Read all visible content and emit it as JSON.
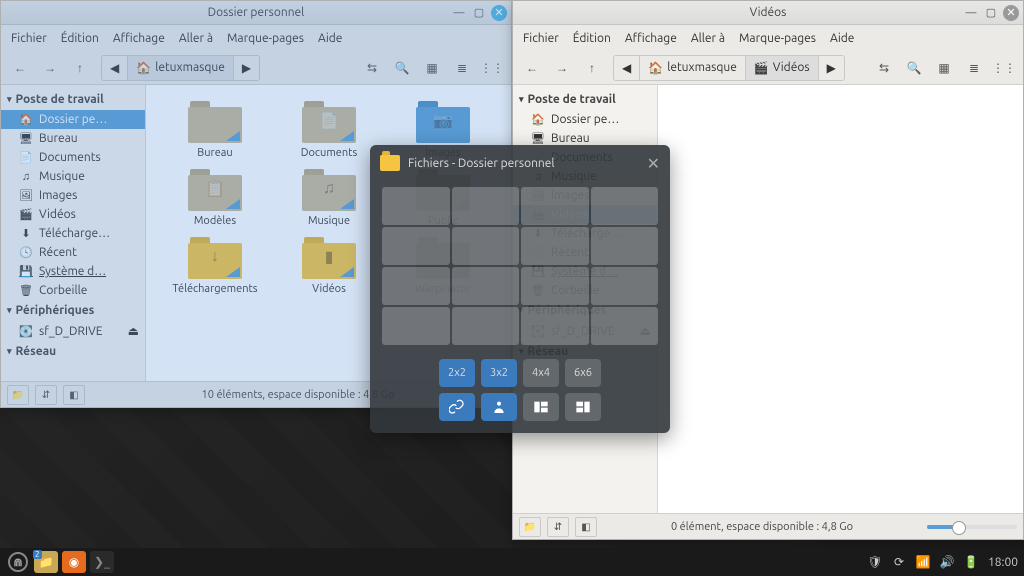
{
  "win_left": {
    "title": "Dossier personnel",
    "menu": [
      "Fichier",
      "Édition",
      "Affichage",
      "Aller à",
      "Marque-pages",
      "Aide"
    ],
    "path_user": "letuxmasque",
    "status": "10 éléments, espace disponible : 4,8 Go",
    "folders": [
      {
        "label": "Bureau",
        "color": "tan",
        "glyph": ""
      },
      {
        "label": "Documents",
        "color": "tan",
        "glyph": "📄"
      },
      {
        "label": "Images",
        "color": "blue",
        "glyph": "📷"
      },
      {
        "label": "Modèles",
        "color": "tan",
        "glyph": "📋"
      },
      {
        "label": "Musique",
        "color": "tan",
        "glyph": "♫"
      },
      {
        "label": "Public",
        "color": "tan",
        "glyph": ""
      },
      {
        "label": "Téléchargements",
        "color": "yel",
        "glyph": "↓"
      },
      {
        "label": "Vidéos",
        "color": "yel",
        "glyph": "▮"
      },
      {
        "label": "Warpinator",
        "color": "tan",
        "glyph": ""
      }
    ]
  },
  "win_right": {
    "title": "Vidéos",
    "menu": [
      "Fichier",
      "Édition",
      "Affichage",
      "Aller à",
      "Marque-pages",
      "Aide"
    ],
    "path_user": "letuxmasque",
    "path_current": "Vidéos",
    "status": "0 élément, espace disponible : 4,8 Go"
  },
  "sidebar": {
    "poste": "Poste de travail",
    "items": [
      {
        "label": "Dossier pe…",
        "glyph": "🏠"
      },
      {
        "label": "Bureau",
        "glyph": "🖥"
      },
      {
        "label": "Documents",
        "glyph": "📄"
      },
      {
        "label": "Musique",
        "glyph": "♫"
      },
      {
        "label": "Images",
        "glyph": "🖼"
      },
      {
        "label": "Vidéos",
        "glyph": "🎬"
      },
      {
        "label": "Télécharge…",
        "glyph": "⬇"
      },
      {
        "label": "Récent",
        "glyph": "🕓"
      },
      {
        "label": "Système d…",
        "glyph": "💾",
        "underline": true
      },
      {
        "label": "Corbeille",
        "glyph": "🗑"
      }
    ],
    "periph": "Périphériques",
    "drive": "sf_D_DRIVE",
    "reseau": "Réseau"
  },
  "overlay": {
    "title": "Fichiers - Dossier personnel",
    "b2x2": "2x2",
    "b3x2": "3x2",
    "b4x4": "4x4",
    "b6x6": "6x6"
  },
  "panel": {
    "time": "18:00",
    "task_badge": "2"
  }
}
